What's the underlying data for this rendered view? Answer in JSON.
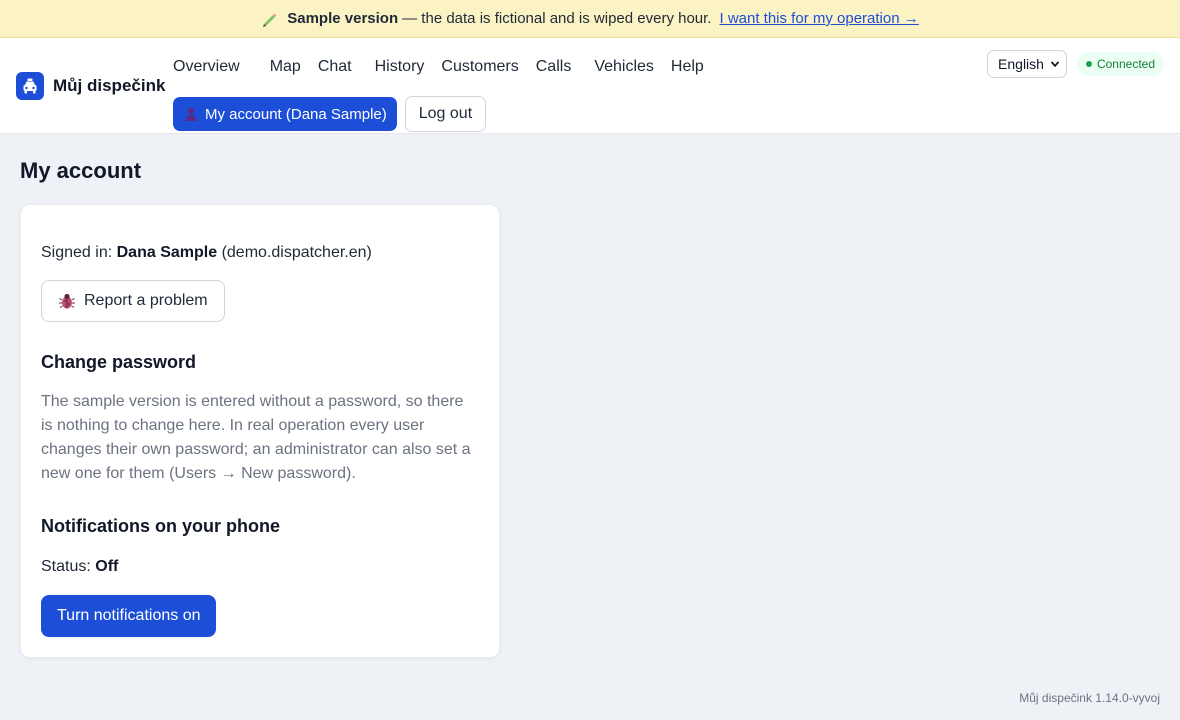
{
  "banner": {
    "title": "Sample version",
    "text": "— the data is fictional and is wiped every hour.",
    "link": "I want this for my operation →"
  },
  "brand": {
    "name": "Můj dispečink"
  },
  "nav": {
    "items": [
      "Overview",
      "Map",
      "Chat",
      "History",
      "Customers",
      "Calls",
      "Vehicles",
      "Help"
    ],
    "account_label": "My account (Dana Sample)",
    "logout_label": "Log out"
  },
  "header": {
    "language": "English",
    "connection_status": "Connected"
  },
  "page": {
    "title": "My account",
    "signed_in_label": "Signed in:",
    "user_name": "Dana Sample",
    "user_login": "(demo.dispatcher.en)",
    "report_label": "Report a problem",
    "password": {
      "heading": "Change password",
      "text": "The sample version is entered without a password, so there is nothing to change here. In real operation every user changes their own password; an administrator can also set a new one for them (Users → New password)."
    },
    "notifications": {
      "heading": "Notifications on your phone",
      "status_label": "Status:",
      "status_value": "Off",
      "button_label": "Turn notifications on"
    }
  },
  "footer": {
    "version": "Můj dispečink 1.14.0-vyvoj"
  },
  "colors": {
    "accent": "#1d4ed8",
    "banner_bg": "#fbf3c4",
    "connected": "#16a34a"
  }
}
